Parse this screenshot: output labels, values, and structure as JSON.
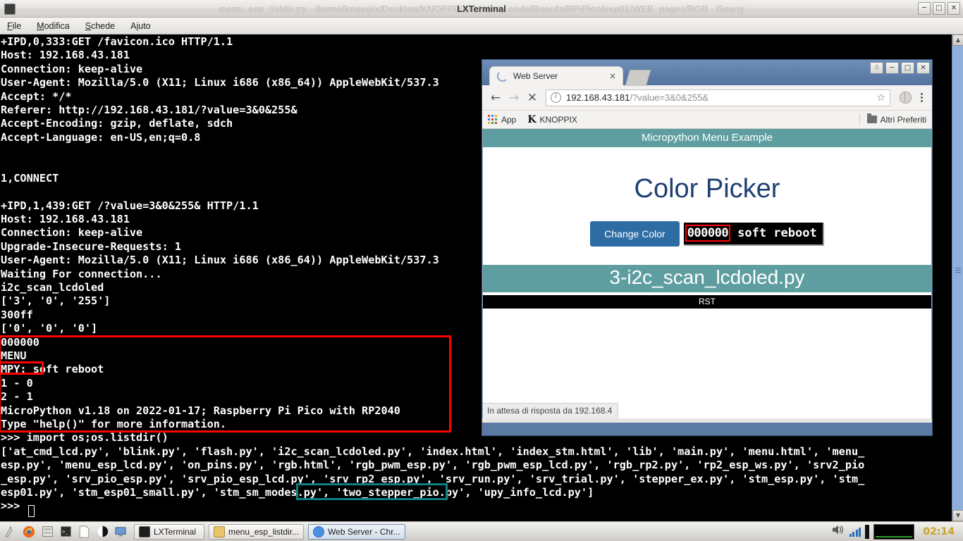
{
  "terminal": {
    "window_title": "LXTerminal",
    "background_window_title": "menu_esp_listdir.py - /home/knoppix/Desktop/KNOPPIX/U...lo/mu_code/Boards/RPiPico/esp01/WEB_pages/RGB - Geany",
    "menu": [
      {
        "label": "File",
        "accel": "F"
      },
      {
        "label": "Modifica",
        "accel": "M"
      },
      {
        "label": "Schede",
        "accel": "S"
      },
      {
        "label": "Aiuto",
        "accel": "A"
      }
    ],
    "window_buttons": [
      "minimize",
      "maximize",
      "close"
    ],
    "lines": [
      "+IPD,0,333:GET /favicon.ico HTTP/1.1",
      "Host: 192.168.43.181",
      "Connection: keep-alive",
      "User-Agent: Mozilla/5.0 (X11; Linux i686 (x86_64)) AppleWebKit/537.3",
      "Accept: */*",
      "Referer: http://192.168.43.181/?value=3&0&255&",
      "Accept-Encoding: gzip, deflate, sdch",
      "Accept-Language: en-US,en;q=0.8",
      "",
      "",
      "1,CONNECT",
      "",
      "+IPD,1,439:GET /?value=3&0&255& HTTP/1.1",
      "Host: 192.168.43.181",
      "Connection: keep-alive",
      "Upgrade-Insecure-Requests: 1",
      "User-Agent: Mozilla/5.0 (X11; Linux i686 (x86_64)) AppleWebKit/537.3",
      "Waiting For connection...",
      "i2c_scan_lcdoled",
      "['3', '0', '255']",
      "300ff",
      "['0', '0', '0']",
      "000000",
      "MENU",
      "MPY: soft reboot",
      "1 - 0",
      "2 - 1",
      "MicroPython v1.18 on 2022-01-17; Raspberry Pi Pico with RP2040",
      "Type \"help()\" for more information.",
      ">>> import os;os.listdir()",
      "['at_cmd_lcd.py', 'blink.py', 'flash.py', 'i2c_scan_lcdoled.py', 'index.html', 'index_stm.html', 'lib', 'main.py', 'menu.html', 'menu_",
      "esp.py', 'menu_esp_lcd.py', 'on_pins.py', 'rgb.html', 'rgb_pwm_esp.py', 'rgb_pwm_esp_lcd.py', 'rgb_rp2.py', 'rp2_esp_ws.py', 'srv2_pio",
      "_esp.py', 'srv_pio_esp.py', 'srv_pio_esp_lcd.py', 'srv_rp2_esp.py', 'srv_run.py', 'srv_trial.py', 'stepper_ex.py', 'stm_esp.py', 'stm_",
      "esp01.py', 'stm_esp01_small.py', 'stm_sm_modes.py', 'two_stepper_pio.py', 'upy_info_lcd.py']",
      ">>> "
    ],
    "highlight_color_red": "#ff0000",
    "highlight_color_teal": "#0f7f7f",
    "text_color": "#ffffff",
    "bg_color": "#000000"
  },
  "browser": {
    "tab": {
      "title": "Web Server",
      "close_label": "×",
      "loading": true
    },
    "nav": {
      "back": "←",
      "forward": "→",
      "stop": "✕"
    },
    "omnibox": {
      "host": "192.168.43.181",
      "rest": "/?value=3&0&255&",
      "full_url": "192.168.43.181/?value=3&0&255&",
      "star": "☆"
    },
    "bookmarks": {
      "apps_label": "App",
      "knoppix_label": "KNOPPIX",
      "knoppix_logo": "K",
      "other_label": "Altri Preferiti"
    },
    "window_buttons": [
      "profile",
      "minimize",
      "maximize",
      "close"
    ],
    "status_text": "In attesa di risposta da 192.168.4"
  },
  "webpage": {
    "banner_top": "Micropython Menu Example",
    "heading": "Color Picker",
    "change_button": "Change Color",
    "overlay": {
      "boxed_value": "000000",
      "text": "soft reboot"
    },
    "banner_file": "3-i2c_scan_lcdoled.py",
    "rst_label": "RST",
    "banner_color": "#5f9ea0",
    "heading_color": "#1f3f73",
    "button_color": "#2e6da4"
  },
  "taskbar": {
    "launchers": [
      "show-desktop-icon",
      "firefox-icon",
      "file-manager-icon",
      "terminal-icon",
      "editor-icon",
      "unknown-icon",
      "display-icon"
    ],
    "windows": [
      {
        "label": "LXTerminal",
        "icon": "terminal-icon"
      },
      {
        "label": "menu_esp_listdir...",
        "icon": "geany-icon"
      },
      {
        "label": "Web Server - Chr...",
        "icon": "chrome-icon"
      }
    ],
    "tray": {
      "volume": "volume-icon",
      "network": "network-icon",
      "monitor": "cpu-graph"
    },
    "clock": "02:14"
  }
}
